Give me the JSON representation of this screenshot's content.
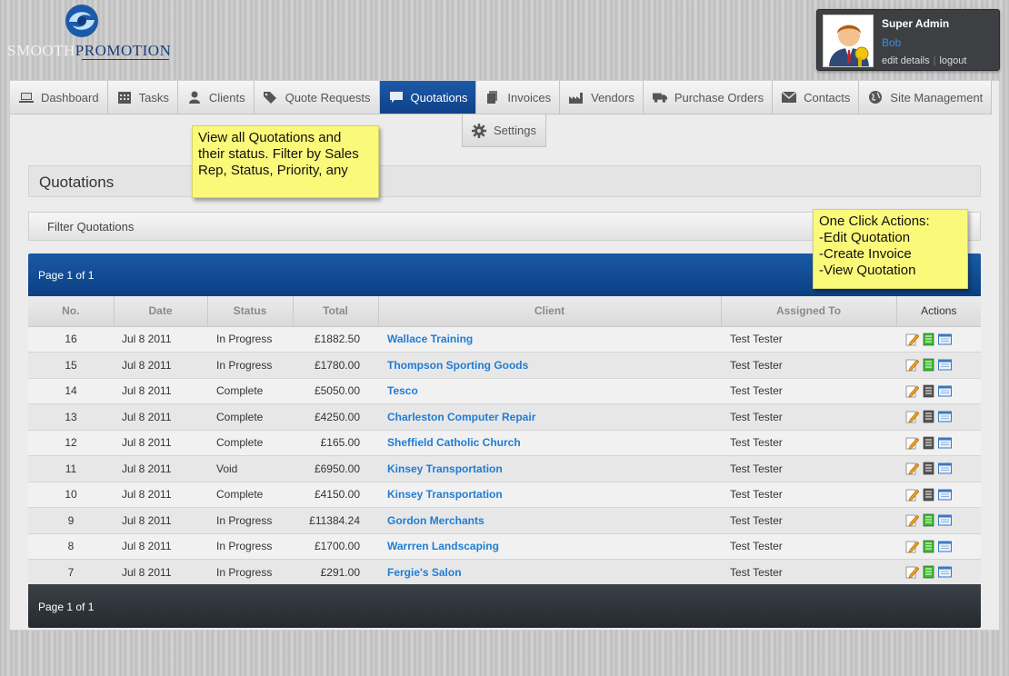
{
  "brand": {
    "name_part1": "SMOOTH",
    "name_part2": "PROMOTION"
  },
  "user": {
    "role": "Super Admin",
    "name": "Bob",
    "edit_label": "edit details",
    "logout_label": "logout",
    "separator": "|"
  },
  "nav": {
    "tabs": [
      {
        "label": "Dashboard",
        "icon": "laptop-icon"
      },
      {
        "label": "Tasks",
        "icon": "calendar-icon"
      },
      {
        "label": "Clients",
        "icon": "user-icon"
      },
      {
        "label": "Quote Requests",
        "icon": "tags-icon"
      },
      {
        "label": "Quotations",
        "icon": "speech-bubble-icon",
        "active": true
      },
      {
        "label": "Invoices",
        "icon": "documents-icon"
      },
      {
        "label": "Vendors",
        "icon": "factory-icon"
      },
      {
        "label": "Purchase Orders",
        "icon": "truck-icon"
      },
      {
        "label": "Contacts",
        "icon": "envelope-icon"
      },
      {
        "label": "Site Management",
        "icon": "globe-icon"
      }
    ],
    "subtab": {
      "label": "Settings",
      "icon": "gear-icon"
    }
  },
  "page": {
    "title": "Quotations",
    "filter_label": "Filter Quotations",
    "pagination_top": "Page 1 of 1",
    "pagination_bottom": "Page 1 of 1"
  },
  "notes": {
    "note1": "View all Quotations and\ntheir status. Filter by Sales\nRep, Status, Priority, any",
    "note2": "One Click Actions:\n-Edit Quotation\n-Create Invoice\n-View Quotation"
  },
  "table": {
    "headers": {
      "no": "No.",
      "date": "Date",
      "status": "Status",
      "total": "Total",
      "client": "Client",
      "assigned": "Assigned To",
      "actions": "Actions"
    },
    "rows": [
      {
        "no": "16",
        "date": "Jul 8 2011",
        "status": "In Progress",
        "total": "£1882.50",
        "client": "Wallace Training",
        "assigned": "Test Tester",
        "invoice_available": true
      },
      {
        "no": "15",
        "date": "Jul 8 2011",
        "status": "In Progress",
        "total": "£1780.00",
        "client": "Thompson Sporting Goods",
        "assigned": "Test Tester",
        "invoice_available": true
      },
      {
        "no": "14",
        "date": "Jul 8 2011",
        "status": "Complete",
        "total": "£5050.00",
        "client": "Tesco",
        "assigned": "Test Tester",
        "invoice_available": false
      },
      {
        "no": "13",
        "date": "Jul 8 2011",
        "status": "Complete",
        "total": "£4250.00",
        "client": "Charleston Computer Repair",
        "assigned": "Test Tester",
        "invoice_available": false
      },
      {
        "no": "12",
        "date": "Jul 8 2011",
        "status": "Complete",
        "total": "£165.00",
        "client": "Sheffield Catholic Church",
        "assigned": "Test Tester",
        "invoice_available": false
      },
      {
        "no": "11",
        "date": "Jul 8 2011",
        "status": "Void",
        "total": "£6950.00",
        "client": "Kinsey Transportation",
        "assigned": "Test Tester",
        "invoice_available": false
      },
      {
        "no": "10",
        "date": "Jul 8 2011",
        "status": "Complete",
        "total": "£4150.00",
        "client": "Kinsey Transportation",
        "assigned": "Test Tester",
        "invoice_available": false
      },
      {
        "no": "9",
        "date": "Jul 8 2011",
        "status": "In Progress",
        "total": "£11384.24",
        "client": "Gordon Merchants",
        "assigned": "Test Tester",
        "invoice_available": true
      },
      {
        "no": "8",
        "date": "Jul 8 2011",
        "status": "In Progress",
        "total": "£1700.00",
        "client": "Warrren Landscaping",
        "assigned": "Test Tester",
        "invoice_available": true
      },
      {
        "no": "7",
        "date": "Jul 8 2011",
        "status": "In Progress",
        "total": "£291.00",
        "client": "Fergie's Salon",
        "assigned": "Test Tester",
        "invoice_available": true
      }
    ]
  },
  "colors": {
    "nav_active": "#0f4188",
    "client_link": "#1f7dd4",
    "note_bg": "#fbf97a",
    "invoice_active": "#3cbf2c",
    "invoice_inactive": "#555555"
  }
}
